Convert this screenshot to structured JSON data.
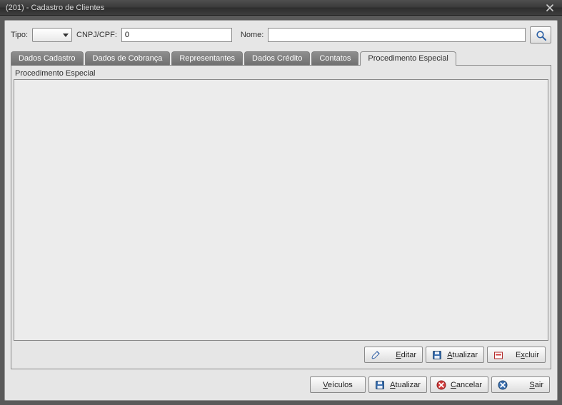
{
  "window": {
    "title": "(201) - Cadastro de Clientes"
  },
  "form": {
    "tipo_label": "Tipo:",
    "cnpjcpf_label": "CNPJ/CPF:",
    "cnpjcpf_value": "0",
    "nome_label": "Nome:",
    "nome_value": ""
  },
  "tabs": [
    "Dados Cadastro",
    "Dados de Cobrança",
    "Representantes",
    "Dados Crédito",
    "Contatos",
    "Procedimento Especial"
  ],
  "active_tab_index": 5,
  "tabcontent": {
    "section_title": "Procedimento Especial"
  },
  "inner_buttons": {
    "editar": "Editar",
    "atualizar": "Atualizar",
    "excluir": "Excluir"
  },
  "bottom_buttons": {
    "veiculos": "Veículos",
    "atualizar": "Atualizar",
    "cancelar": "Cancelar",
    "sair": "Sair"
  }
}
